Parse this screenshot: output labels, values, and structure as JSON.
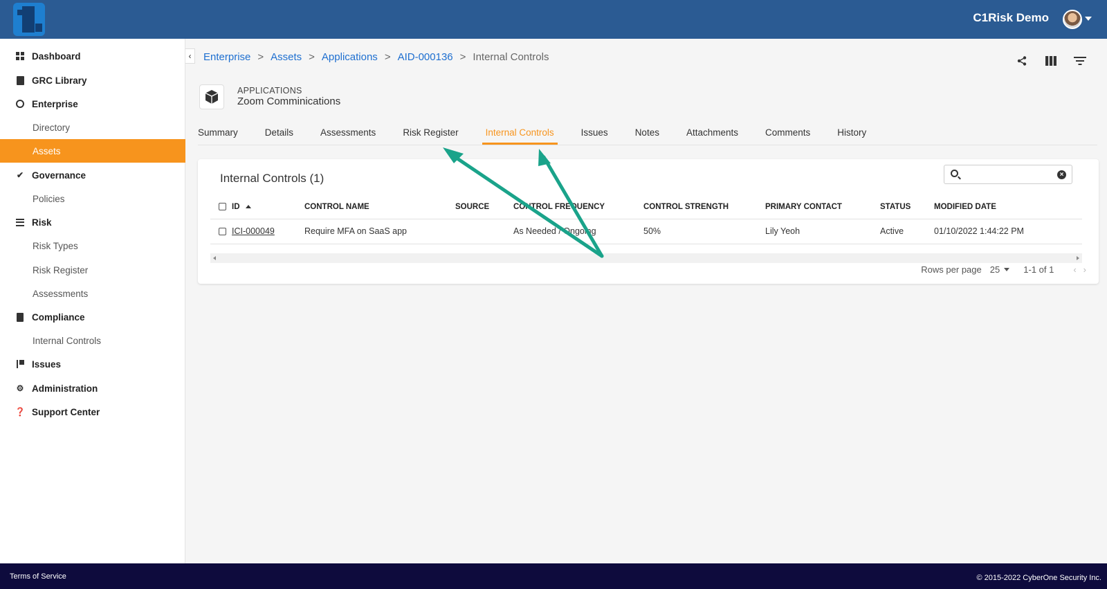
{
  "header": {
    "user_name": "C1Risk Demo"
  },
  "sidebar": {
    "items": [
      {
        "label": "Dashboard"
      },
      {
        "label": "GRC Library"
      },
      {
        "label": "Enterprise"
      },
      {
        "label": "Directory"
      },
      {
        "label": "Assets"
      },
      {
        "label": "Governance"
      },
      {
        "label": "Policies"
      },
      {
        "label": "Risk"
      },
      {
        "label": "Risk Types"
      },
      {
        "label": "Risk Register"
      },
      {
        "label": "Assessments"
      },
      {
        "label": "Compliance"
      },
      {
        "label": "Internal Controls"
      },
      {
        "label": "Issues"
      },
      {
        "label": "Administration"
      },
      {
        "label": "Support Center"
      }
    ],
    "active": "Assets"
  },
  "breadcrumb": {
    "items": [
      "Enterprise",
      "Assets",
      "Applications",
      "AID-000136"
    ],
    "current": "Internal Controls",
    "separator": ">"
  },
  "record": {
    "type": "APPLICATIONS",
    "name": "Zoom Comminications"
  },
  "tabs": [
    "Summary",
    "Details",
    "Assessments",
    "Risk Register",
    "Internal Controls",
    "Issues",
    "Notes",
    "Attachments",
    "Comments",
    "History"
  ],
  "active_tab": "Internal Controls",
  "card": {
    "title": "Internal Controls (1)",
    "search_value": "",
    "columns": [
      "ID",
      "CONTROL NAME",
      "SOURCE",
      "CONTROL FREQUENCY",
      "CONTROL STRENGTH",
      "PRIMARY CONTACT",
      "STATUS",
      "MODIFIED DATE"
    ],
    "rows": [
      {
        "id": "ICI-000049",
        "control_name": "Require MFA on SaaS app",
        "source": "",
        "frequency": "As Needed / Ongoing",
        "strength": "50%",
        "contact": "Lily Yeoh",
        "status": "Active",
        "modified": "01/10/2022 1:44:22 PM"
      }
    ],
    "pagination": {
      "rows_per_page_label": "Rows per page",
      "rows_per_page": "25",
      "range": "1-1 of 1"
    }
  },
  "footer": {
    "terms": "Terms of Service",
    "copyright": "© 2015-2022 CyberOne Security Inc."
  },
  "colors": {
    "topbar": "#2b5b93",
    "accent": "#f7941d",
    "link": "#1e6fd0",
    "footer": "#0e0b3d",
    "annotation_arrow": "#1aa38a"
  }
}
